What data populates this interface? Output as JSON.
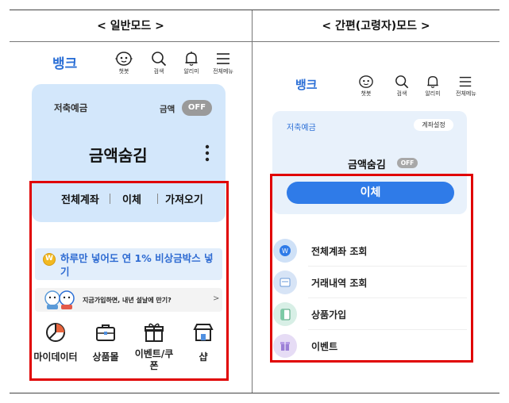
{
  "header": {
    "left_title": "< 일반모드 >",
    "right_title": "< 간편(고령자)모드 >"
  },
  "normal": {
    "logo": "뱅크",
    "nav": [
      {
        "icon": "chatbot-icon",
        "label": "챗봇"
      },
      {
        "icon": "search-icon",
        "label": "검색"
      },
      {
        "icon": "bell-icon",
        "label": "알리미"
      },
      {
        "icon": "menu-icon",
        "label": "전체메뉴"
      }
    ],
    "account_label": "저축예금",
    "amount_label": "금액",
    "toggle_text": "OFF",
    "hidden_amount": "금액숨김",
    "tabs": [
      "전체계좌",
      "이체",
      "가져오기"
    ],
    "promo": {
      "coin": "W",
      "line1": "하루만 넣어도 연 1% 비상금박스 넣",
      "line2": "기"
    },
    "banner_text": "지금가입하면, 내년 설날에 만기?",
    "banner_arrow": ">",
    "menu": [
      {
        "icon": "pie-chart-icon",
        "label": "마이데이터",
        "label2": ""
      },
      {
        "icon": "briefcase-icon",
        "label": "상품몰",
        "label2": ""
      },
      {
        "icon": "gift-icon",
        "label": "이벤트/쿠",
        "label2": "폰"
      },
      {
        "icon": "shop-icon",
        "label": "샵",
        "label2": ""
      }
    ]
  },
  "simple": {
    "logo": "뱅크",
    "nav": [
      {
        "icon": "chatbot-icon",
        "label": "챗봇"
      },
      {
        "icon": "search-icon",
        "label": "검색"
      },
      {
        "icon": "bell-icon",
        "label": "알리미"
      },
      {
        "icon": "menu-icon",
        "label": "전체메뉴"
      }
    ],
    "account_label": "저축예금",
    "settings_pill": "계좌설정",
    "hidden_amount": "금액숨김",
    "toggle_text": "OFF",
    "transfer_button": "이체",
    "list": [
      {
        "icon": "all-accounts-icon",
        "label": "전체계좌 조회",
        "color": "#cfe1f7"
      },
      {
        "icon": "transaction-history-icon",
        "label": "거래내역 조회",
        "color": "#d7e4f6"
      },
      {
        "icon": "product-signup-icon",
        "label": "상품가입",
        "color": "#d8efe6"
      },
      {
        "icon": "event-icon",
        "label": "이벤트",
        "color": "#e6dcf5"
      }
    ]
  },
  "colors": {
    "highlight_red": "#e00000",
    "brand_blue": "#2b6fd6",
    "card_blue": "#d3e7fb"
  }
}
